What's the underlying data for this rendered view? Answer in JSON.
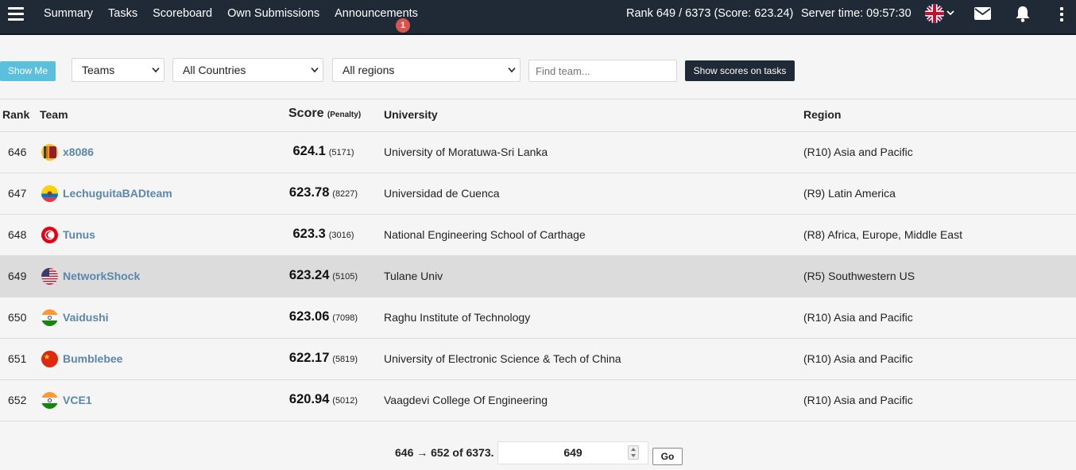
{
  "nav": {
    "links": [
      "Summary",
      "Tasks",
      "Scoreboard",
      "Own Submissions",
      "Announcements"
    ],
    "announcements_badge": "1",
    "rank_info": "Rank 649 / 6373 (Score: 623.24)",
    "server_time": "Server time: 09:57:30",
    "icons": [
      "menu-icon",
      "uk-flag-icon",
      "chevron-down-icon",
      "envelope-icon",
      "bell-icon",
      "kebab-menu-icon"
    ]
  },
  "filters": {
    "show_me": "Show Me",
    "type_select": "Teams",
    "country_select": "All Countries",
    "region_select": "All regions",
    "find_placeholder": "Find team...",
    "show_scores_button": "Show scores on tasks"
  },
  "table": {
    "headers": {
      "rank": "Rank",
      "team": "Team",
      "score": "Score",
      "penalty": "(Penalty)",
      "university": "University",
      "region": "Region"
    },
    "rows": [
      {
        "rank": "646",
        "flag": "sri-lanka",
        "team": "x8086",
        "score": "624.1",
        "penalty": "(5171)",
        "university": "University of Moratuwa-Sri Lanka",
        "region": "(R10) Asia and Pacific",
        "highlight": false
      },
      {
        "rank": "647",
        "flag": "ecuador",
        "team": "LechuguitaBADteam",
        "score": "623.78",
        "penalty": "(8227)",
        "university": "Universidad de Cuenca",
        "region": "(R9) Latin America",
        "highlight": false
      },
      {
        "rank": "648",
        "flag": "tunisia",
        "team": "Tunus",
        "score": "623.3",
        "penalty": "(3016)",
        "university": "National Engineering School of Carthage",
        "region": "(R8) Africa, Europe, Middle East",
        "highlight": false
      },
      {
        "rank": "649",
        "flag": "usa",
        "team": "NetworkShock",
        "score": "623.24",
        "penalty": "(5105)",
        "university": "Tulane Univ",
        "region": "(R5) Southwestern US",
        "highlight": true
      },
      {
        "rank": "650",
        "flag": "india",
        "team": "Vaidushi",
        "score": "623.06",
        "penalty": "(7098)",
        "university": "Raghu Institute of Technology",
        "region": "(R10) Asia and Pacific",
        "highlight": false
      },
      {
        "rank": "651",
        "flag": "china",
        "team": "Bumblebee",
        "score": "622.17",
        "penalty": "(5819)",
        "university": "University of Electronic Science & Tech of China",
        "region": "(R10) Asia and Pacific",
        "highlight": false
      },
      {
        "rank": "652",
        "flag": "india",
        "team": "VCE1",
        "score": "620.94",
        "penalty": "(5012)",
        "university": "Vaagdevi College Of Engineering",
        "region": "(R10) Asia and Pacific",
        "highlight": false
      }
    ]
  },
  "pagination": {
    "range": "646 → 652 of 6373.",
    "page_value": "649",
    "go": "Go"
  },
  "colors": {
    "navbar_bg": "#1f2a36",
    "show_me_bg": "#5bc0de",
    "team_link": "#5b87ad",
    "highlight_row": "#dcdcdc",
    "badge": "#d9534f"
  }
}
